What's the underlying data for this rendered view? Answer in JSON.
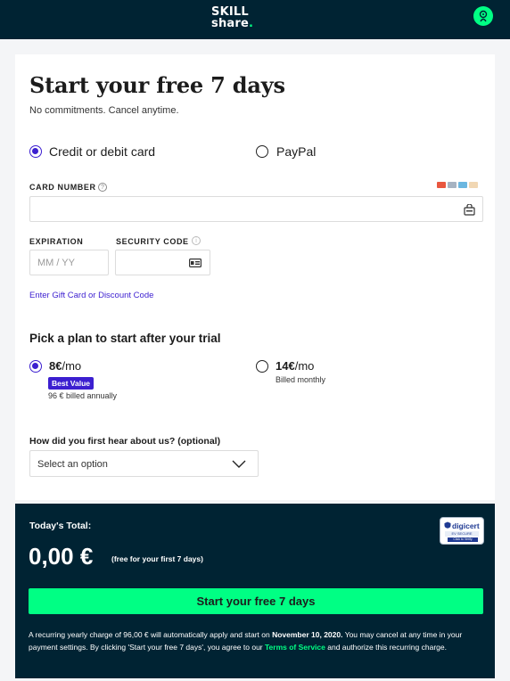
{
  "header": {
    "logo_line1": "SKILL",
    "logo_line2": "share",
    "logo_dot": "."
  },
  "title": "Start your free 7 days",
  "subtitle": "No commitments. Cancel anytime.",
  "payment": {
    "options": [
      {
        "label": "Credit or debit card",
        "selected": true
      },
      {
        "label": "PayPal",
        "selected": false
      }
    ],
    "card_number_label": "CARD NUMBER",
    "card_number_value": "",
    "expiration_label": "EXPIRATION",
    "expiration_placeholder": "MM / YY",
    "security_label": "SECURITY CODE",
    "security_value": "",
    "gift_link": "Enter Gift Card or Discount Code",
    "card_brand_icons": [
      "mastercard-icon",
      "amex-icon",
      "visa-icon",
      "other-card-icon"
    ]
  },
  "plan": {
    "title": "Pick a plan to start after your trial",
    "options": [
      {
        "price": "8€",
        "period": "/mo",
        "badge": "Best Value",
        "note": "96 € billed annually",
        "selected": true
      },
      {
        "price": "14€",
        "period": "/mo",
        "note": "Billed monthly",
        "selected": false
      }
    ]
  },
  "survey": {
    "question": "How did you first hear about us? (optional)",
    "selected": "Select an option"
  },
  "total": {
    "label": "Today's Total:",
    "amount": "0,00 €",
    "note": "(free for your first 7 days)",
    "badge_brand": "digicert",
    "badge_line1": "EV SECURE",
    "badge_line2": "Click to Verify",
    "cta": "Start your free 7 days",
    "legal_part1": "A recurring yearly charge of 96,00 € will automatically apply and start on ",
    "legal_date": "November 10, 2020.",
    "legal_part2": " You may cancel at any time in your payment settings. By clicking 'Start your free 7 days', you agree to our ",
    "legal_link": "Terms of Service",
    "legal_part3": " and authorize this recurring charge."
  },
  "colors": {
    "brand_dark": "#002333",
    "accent_green": "#00ff84",
    "accent_purple": "#3c1fd0"
  }
}
